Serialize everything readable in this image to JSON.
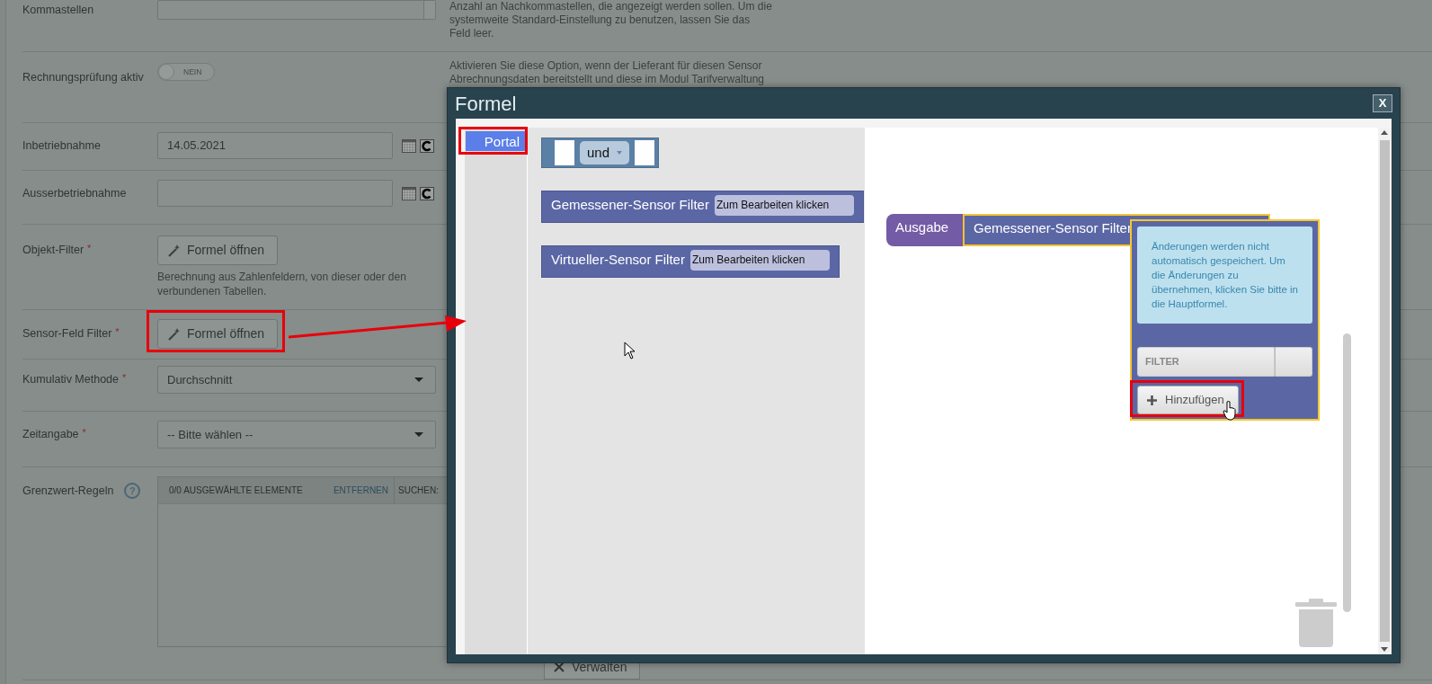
{
  "form": {
    "rows": [
      {
        "kind": "number",
        "label": "Kommastellen",
        "help": "Anzahl an Nachkommastellen, die angezeigt werden sollen. Um die systemweite Standard-Einstellung zu benutzen, lassen Sie das Feld leer."
      },
      {
        "kind": "toggle",
        "label": "Rechnungsprüfung aktiv",
        "on": false,
        "toggle_text": "NEIN",
        "help": "Aktivieren Sie diese Option, wenn der Lieferant für diesen Sensor Abrechnungsdaten bereitstellt und diese im Modul Tarifverwaltung"
      },
      {
        "kind": "date",
        "label": "Inbetriebnahme",
        "value": "14.05.2021"
      },
      {
        "kind": "date",
        "label": "Ausserbetriebnahme"
      },
      {
        "kind": "formula",
        "label": "Objekt-Filter",
        "required_mark": "*",
        "button": "Formel öffnen",
        "note": "Berechnung aus Zahlenfeldern, von dieser oder den verbundenen Tabellen."
      },
      {
        "kind": "formula",
        "label": "Sensor-Feld Filter",
        "required_mark": "*",
        "button": "Formel öffnen"
      },
      {
        "kind": "select",
        "label": "Kumulativ Methode",
        "required_mark": "*",
        "value": "Durchschnitt"
      },
      {
        "kind": "select",
        "label": "Zeitangabe",
        "required_mark": "*",
        "value": "-- Bitte wählen --"
      },
      {
        "kind": "duallist",
        "label": "Grenzwert-Regeln",
        "help_mark": "?",
        "selected_count": "0/0 AUSGEWÄHLTE ELEMENTE",
        "remove": "ENTFERNEN",
        "search_label": "SUCHEN:",
        "button": "Verwalten"
      }
    ]
  },
  "modal": {
    "title": "Formel",
    "close": "X",
    "toolbox": [
      {
        "label": "Portal",
        "selected": true
      }
    ],
    "flyout": [
      {
        "kind": "logic",
        "label": "und"
      },
      {
        "kind": "filter",
        "label": "Gemessener-Sensor Filter",
        "field": "Zum Bearbeiten klicken"
      },
      {
        "kind": "filter",
        "label": "Virtueller-Sensor Filter",
        "field": "Zum Bearbeiten klicken"
      }
    ],
    "workspace": {
      "output_label": "Ausgabe",
      "block_label": "Gemessener-Sensor Filter",
      "selected": true,
      "mutator": {
        "note": "Änderungen werden nicht automatisch gespeichert. Um die Änderungen zu übernehmen, klicken Sie bitte in die Hauptformel.",
        "filter_placeholder": "FILTER",
        "add_button": "Hinzufügen"
      }
    }
  }
}
